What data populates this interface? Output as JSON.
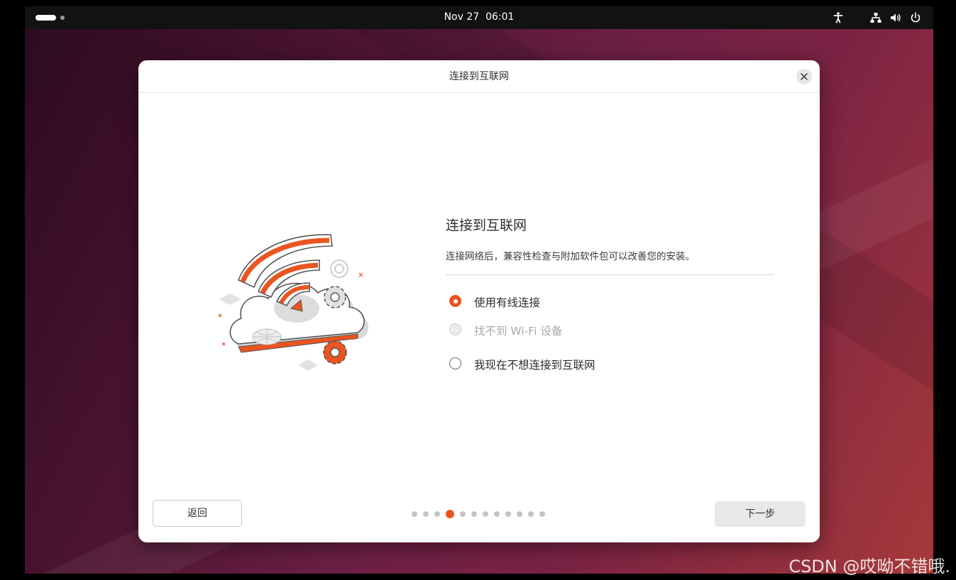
{
  "topbar": {
    "clock": "Nov 27  06:01",
    "tray_icons": [
      "accessibility-icon",
      "network-wired-icon",
      "volume-icon",
      "power-icon"
    ]
  },
  "dialog": {
    "title": "连接到互联网",
    "heading": "连接到互联网",
    "description": "连接网络后，兼容性检查与附加软件包可以改善您的安装。",
    "options": [
      {
        "label": "使用有线连接",
        "state": "checked"
      },
      {
        "label": "找不到 Wi-Fi 设备",
        "state": "disabled"
      },
      {
        "label": "我现在不想连接到互联网",
        "state": "unchecked"
      }
    ],
    "back_label": "返回",
    "next_label": "下一步",
    "pager": {
      "total": 12,
      "current": 4
    }
  },
  "colors": {
    "accent": "#e95420",
    "topbar": "#121212"
  },
  "watermark": "CSDN @哎呦不错哦."
}
